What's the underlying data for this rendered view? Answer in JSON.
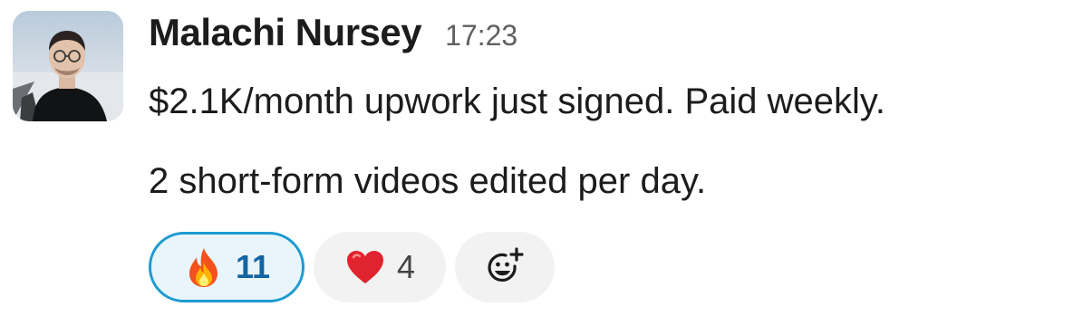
{
  "message": {
    "sender": "Malachi Nursey",
    "time": "17:23",
    "lines": [
      "$2.1K/month upwork just signed. Paid weekly.",
      "2 short-form videos edited per day."
    ]
  },
  "reactions": [
    {
      "emoji": "fire-icon",
      "count": "11",
      "active": true
    },
    {
      "emoji": "heart-icon",
      "count": "4",
      "active": false
    }
  ],
  "add_reaction_icon": "add-reaction-icon",
  "colors": {
    "active_border": "#1d9bd1",
    "active_bg": "#e8f5fa",
    "active_count": "#1264a3",
    "reaction_bg": "#f2f2f2",
    "timestamp": "#616061",
    "text": "#1d1c1d"
  }
}
